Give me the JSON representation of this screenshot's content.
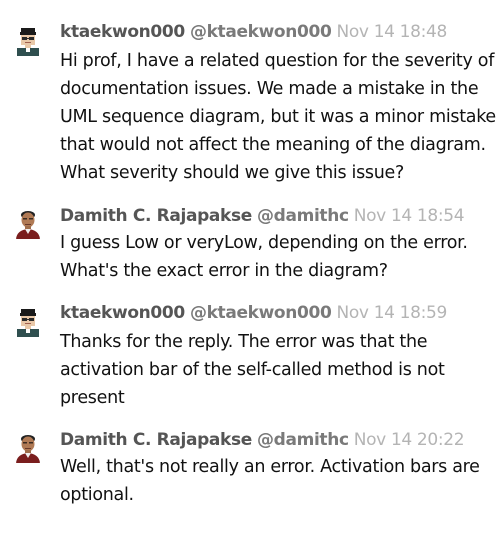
{
  "messages": [
    {
      "username": "ktaekwon000",
      "handle": "@ktaekwon000",
      "time": "Nov 14 18:48",
      "avatar": "pixel-person-avatar",
      "text": "Hi prof, I have a related question for the severity of documentation issues. We made a mistake in the UML sequence diagram, but it was a minor mistake that would not affect the meaning of the diagram. What severity should we give this issue?"
    },
    {
      "username": "Damith C. Rajapakse",
      "handle": "@damithc",
      "time": "Nov 14 18:54",
      "avatar": "photo-person-avatar",
      "text": "I guess Low or veryLow, depending on the error. What's the exact error in the diagram?"
    },
    {
      "username": "ktaekwon000",
      "handle": "@ktaekwon000",
      "time": "Nov 14 18:59",
      "avatar": "pixel-person-avatar",
      "text": "Thanks for the reply. The error was that the activation bar of the self-called method is not present"
    },
    {
      "username": "Damith C. Rajapakse",
      "handle": "@damithc",
      "time": "Nov 14 20:22",
      "avatar": "photo-person-avatar",
      "text": "Well, that's not really an error. Activation bars are optional."
    }
  ]
}
